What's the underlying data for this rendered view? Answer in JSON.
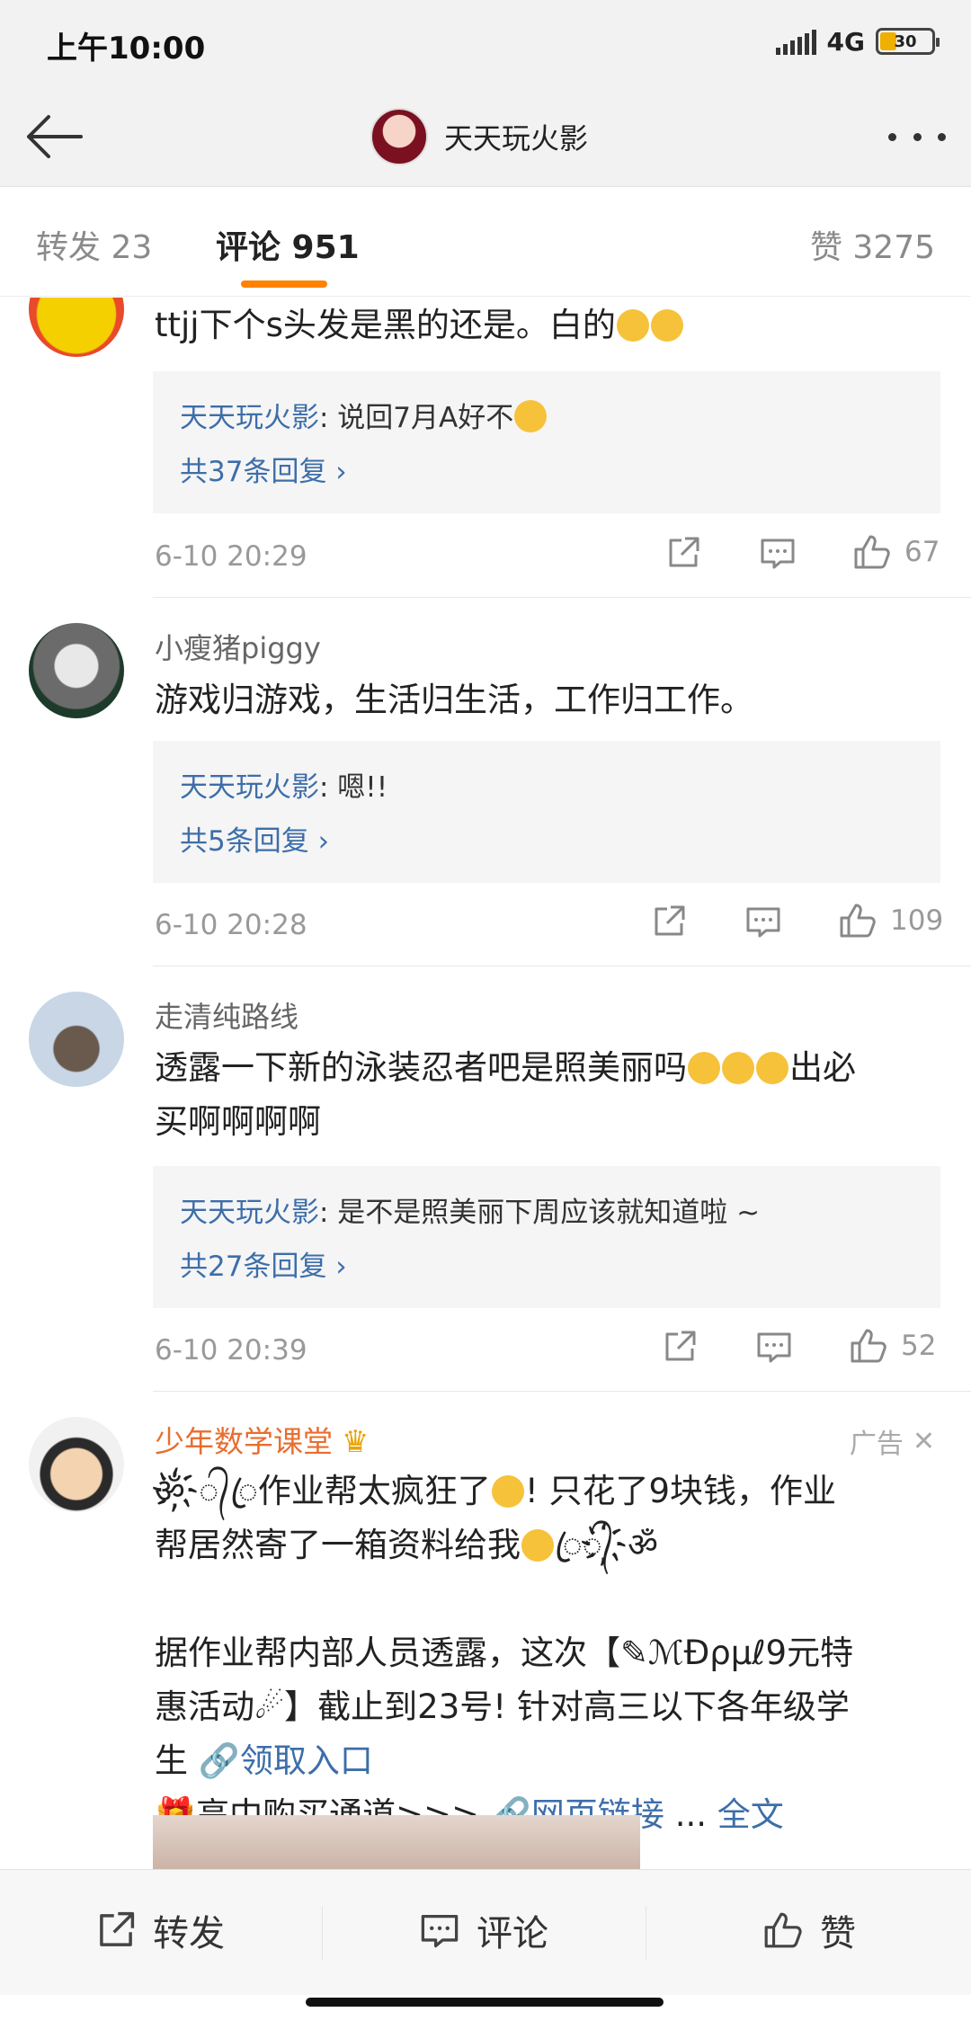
{
  "status_bar": {
    "time": "上午10:00",
    "network": "4G",
    "battery": "30"
  },
  "header": {
    "title": "天天玩火影",
    "back_icon": "arrow-left-icon",
    "more_icon": "more-dots-icon"
  },
  "tabs": [
    {
      "label": "转发 23",
      "active": false
    },
    {
      "label": "评论 951",
      "active": true
    },
    {
      "label": "赞 3275",
      "active": false
    }
  ],
  "comments": [
    {
      "text": "ttjj下个s头发是黑的还是。白的",
      "reply": {
        "author": "天天玩火影",
        "text": ": 说回7月A好不",
        "count": "共37条回复 ›"
      },
      "time": "6-10 20:29",
      "likes": "67"
    },
    {
      "username": "小瘦猪piggy",
      "text": "游戏归游戏，生活归生活，工作归工作。",
      "reply": {
        "author": "天天玩火影",
        "text": ": 嗯!!",
        "count": "共5条回复 ›"
      },
      "time": "6-10 20:28",
      "likes": "109"
    },
    {
      "username": "走清纯路线",
      "text_line1": "透露一下新的泳装忍者吧是照美丽吗",
      "text_line1_tail": "出必",
      "text_line2": "买啊啊啊啊",
      "reply": {
        "author": "天天玩火影",
        "text": ": 是不是照美丽下周应该就知道啦 ~",
        "count": "共27条回复 ›"
      },
      "time": "6-10 20:39",
      "likes": "52"
    }
  ],
  "ad": {
    "username": "少年数学课堂",
    "crown": "♛",
    "tag": "广告",
    "close": "✕",
    "line1_deco": "ॐ҉᭄ꦿ",
    "line1": "作业帮太疯狂了",
    "line1_tail": "! 只花了9块钱，作业",
    "line2": "帮居然寄了一箱资料给我",
    "line2_deco": "ꦿ᭄҉ॐ",
    "line3": "据作业帮内部人员透露，这次【✎ℳÐρμℓ9元特",
    "line4": "惠活动☄】截止到23号! 针对高三以下各年级学",
    "line5_prefix": "生 ",
    "line5_link": "🔗领取入口",
    "line6_icon": "🎁",
    "line6_text": "高中购买通道>>> ",
    "line6_link": "🔗网页链接",
    "line6_more": " ... ",
    "line6_full": "全文"
  },
  "bottom_bar": {
    "repost": "转发",
    "comment": "评论",
    "like": "赞"
  },
  "colors": {
    "accent": "#ff8200",
    "link": "#3d6ea9",
    "ad_name": "#e76e2e"
  }
}
